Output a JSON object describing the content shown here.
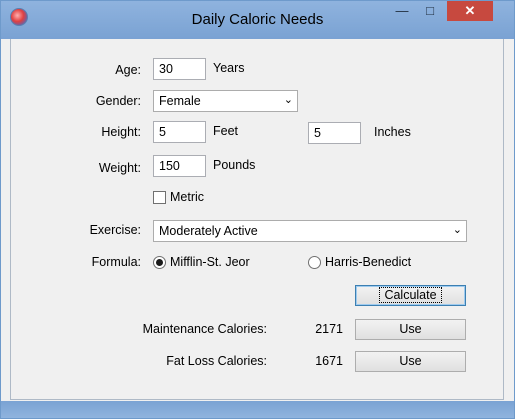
{
  "window": {
    "title": "Daily Caloric Needs"
  },
  "controls": {
    "minimize": "—",
    "maximize": "□",
    "close": "✕"
  },
  "age": {
    "label": "Age:",
    "value": "30",
    "unit": "Years"
  },
  "gender": {
    "label": "Gender:",
    "value": "Female"
  },
  "height": {
    "label": "Height:",
    "feet_value": "5",
    "feet_unit": "Feet",
    "inches_value": "5",
    "inches_unit": "Inches"
  },
  "weight": {
    "label": "Weight:",
    "value": "150",
    "unit": "Pounds"
  },
  "metric": {
    "label": "Metric",
    "checked": false
  },
  "exercise": {
    "label": "Exercise:",
    "value": "Moderately Active"
  },
  "formula": {
    "label": "Formula:",
    "options": [
      "Mifflin-St. Jeor",
      "Harris-Benedict"
    ],
    "selected": "Mifflin-St. Jeor"
  },
  "calculate_label": "Calculate",
  "maintenance": {
    "label": "Maintenance Calories:",
    "value": "2171",
    "button": "Use"
  },
  "fatloss": {
    "label": "Fat Loss Calories:",
    "value": "1671",
    "button": "Use"
  }
}
